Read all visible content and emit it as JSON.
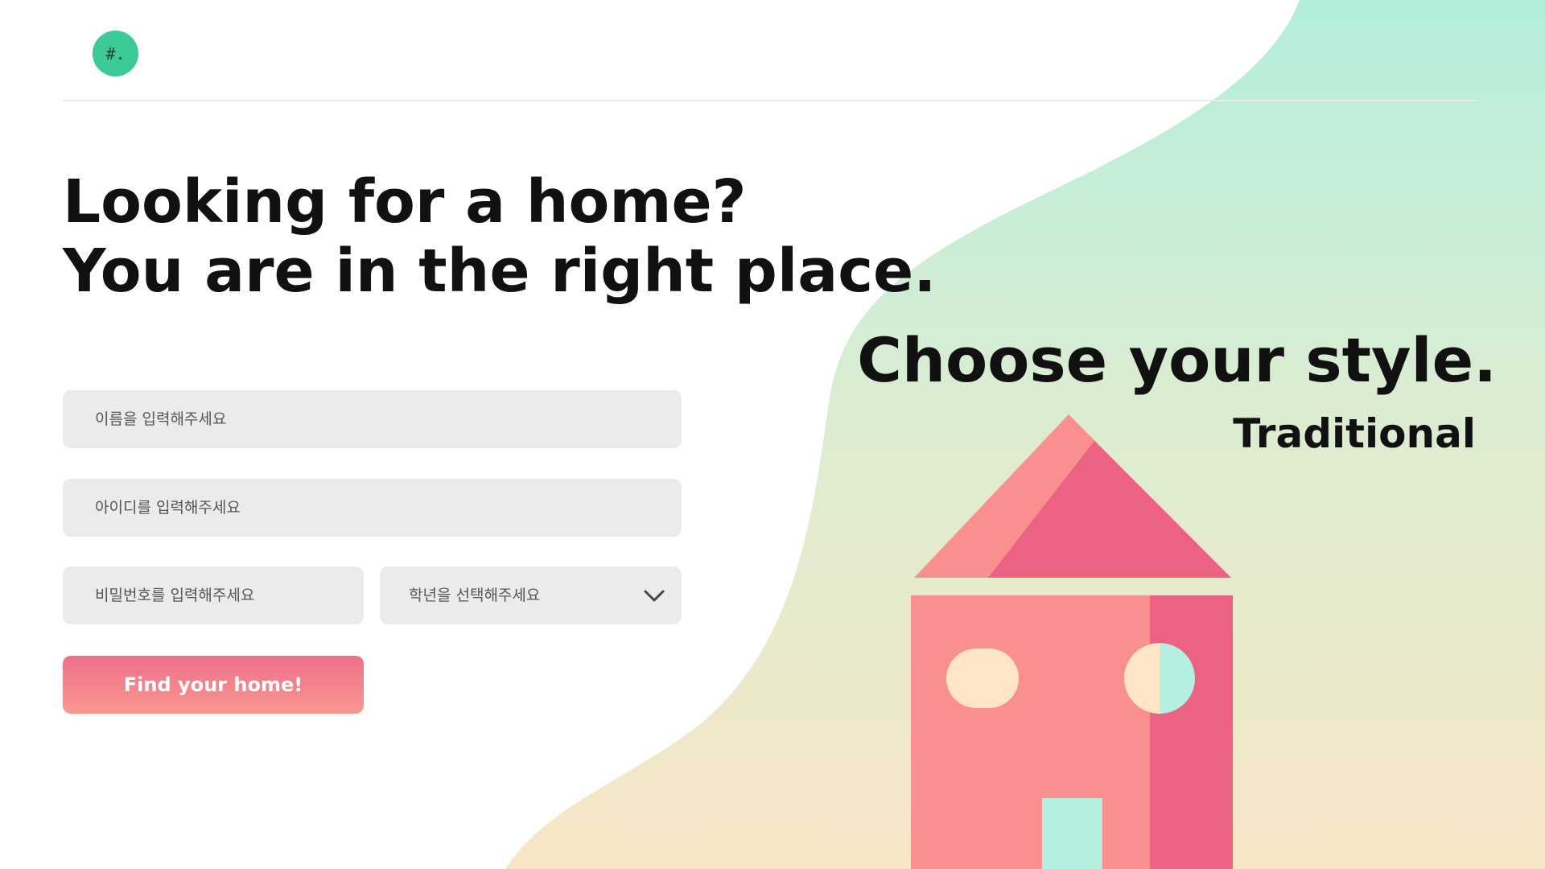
{
  "logo": {
    "text": "#."
  },
  "hero": {
    "line1": "Looking for a home?",
    "line2": "You are in the right place."
  },
  "form": {
    "name_placeholder": "이름을 입력해주세요",
    "id_placeholder": "아이디를 입력해주세요",
    "password_placeholder": "비밀번호를 입력해주세요",
    "grade_select_label": "학년을 선택해주세요",
    "submit_label": "Find your home!"
  },
  "style_panel": {
    "title": "Choose your style.",
    "style_name": "Traditional"
  },
  "colors": {
    "accent_green": "#3cca97",
    "button_pink": "#ef6f8a",
    "field_gray": "#ebebeb",
    "gradient_top": "#b3eedb",
    "gradient_bottom": "#f8e6c6",
    "house_salmon": "#f98f8e",
    "house_rose": "#eb6282",
    "house_cream": "#fde5c5",
    "house_mint": "#b4efe0"
  },
  "icons": {
    "select_arrow": "chevron-down-icon",
    "illustration": "house-illustration"
  }
}
